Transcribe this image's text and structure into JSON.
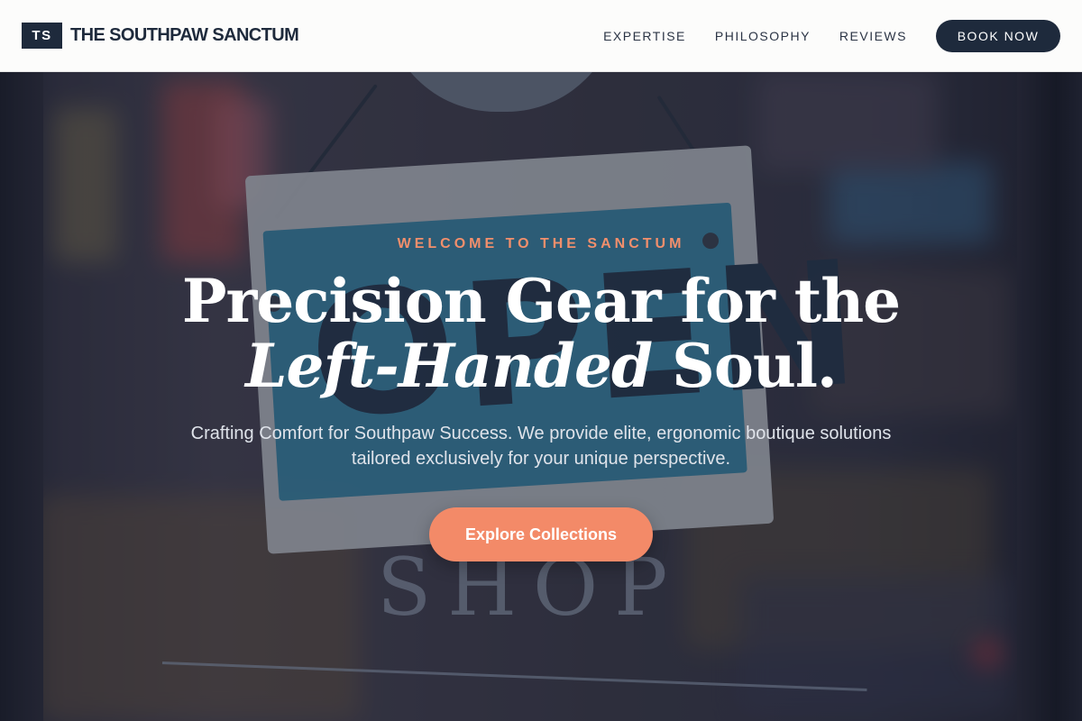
{
  "brand": {
    "mark": "TS",
    "name": "THE SOUTHPAW SANCTUM"
  },
  "nav": {
    "items": [
      "EXPERTISE",
      "PHILOSOPHY",
      "REVIEWS"
    ],
    "cta_label": "BOOK NOW"
  },
  "hero": {
    "eyebrow": "WELCOME TO THE SANCTUM",
    "headline_line1": "Precision Gear for the",
    "headline_emphasis": "Left-Handed",
    "headline_end": " Soul.",
    "subtitle": "Crafting Comfort for Southpaw Success. We provide elite, ergonomic boutique solutions tailored exclusively for your unique perspective.",
    "cta_label": "Explore Collections"
  },
  "background_photo": {
    "sign_word": "OPEN",
    "door_text": "SHOP"
  },
  "colors": {
    "navy": "#1e2a3c",
    "accent": "#f38a68",
    "eyebrow": "#f28f6c",
    "header_bg": "#fcfcfb"
  }
}
